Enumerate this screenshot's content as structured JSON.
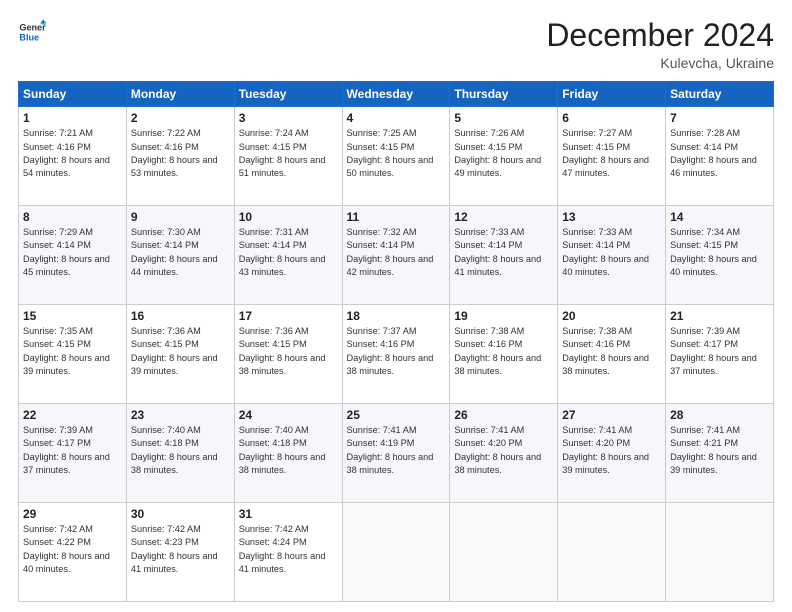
{
  "header": {
    "logo_line1": "General",
    "logo_line2": "Blue",
    "month_title": "December 2024",
    "location": "Kulevcha, Ukraine"
  },
  "days_of_week": [
    "Sunday",
    "Monday",
    "Tuesday",
    "Wednesday",
    "Thursday",
    "Friday",
    "Saturday"
  ],
  "weeks": [
    [
      {
        "day": "1",
        "sunrise": "7:21 AM",
        "sunset": "4:16 PM",
        "daylight": "8 hours and 54 minutes."
      },
      {
        "day": "2",
        "sunrise": "7:22 AM",
        "sunset": "4:16 PM",
        "daylight": "8 hours and 53 minutes."
      },
      {
        "day": "3",
        "sunrise": "7:24 AM",
        "sunset": "4:15 PM",
        "daylight": "8 hours and 51 minutes."
      },
      {
        "day": "4",
        "sunrise": "7:25 AM",
        "sunset": "4:15 PM",
        "daylight": "8 hours and 50 minutes."
      },
      {
        "day": "5",
        "sunrise": "7:26 AM",
        "sunset": "4:15 PM",
        "daylight": "8 hours and 49 minutes."
      },
      {
        "day": "6",
        "sunrise": "7:27 AM",
        "sunset": "4:15 PM",
        "daylight": "8 hours and 47 minutes."
      },
      {
        "day": "7",
        "sunrise": "7:28 AM",
        "sunset": "4:14 PM",
        "daylight": "8 hours and 46 minutes."
      }
    ],
    [
      {
        "day": "8",
        "sunrise": "7:29 AM",
        "sunset": "4:14 PM",
        "daylight": "8 hours and 45 minutes."
      },
      {
        "day": "9",
        "sunrise": "7:30 AM",
        "sunset": "4:14 PM",
        "daylight": "8 hours and 44 minutes."
      },
      {
        "day": "10",
        "sunrise": "7:31 AM",
        "sunset": "4:14 PM",
        "daylight": "8 hours and 43 minutes."
      },
      {
        "day": "11",
        "sunrise": "7:32 AM",
        "sunset": "4:14 PM",
        "daylight": "8 hours and 42 minutes."
      },
      {
        "day": "12",
        "sunrise": "7:33 AM",
        "sunset": "4:14 PM",
        "daylight": "8 hours and 41 minutes."
      },
      {
        "day": "13",
        "sunrise": "7:33 AM",
        "sunset": "4:14 PM",
        "daylight": "8 hours and 40 minutes."
      },
      {
        "day": "14",
        "sunrise": "7:34 AM",
        "sunset": "4:15 PM",
        "daylight": "8 hours and 40 minutes."
      }
    ],
    [
      {
        "day": "15",
        "sunrise": "7:35 AM",
        "sunset": "4:15 PM",
        "daylight": "8 hours and 39 minutes."
      },
      {
        "day": "16",
        "sunrise": "7:36 AM",
        "sunset": "4:15 PM",
        "daylight": "8 hours and 39 minutes."
      },
      {
        "day": "17",
        "sunrise": "7:36 AM",
        "sunset": "4:15 PM",
        "daylight": "8 hours and 38 minutes."
      },
      {
        "day": "18",
        "sunrise": "7:37 AM",
        "sunset": "4:16 PM",
        "daylight": "8 hours and 38 minutes."
      },
      {
        "day": "19",
        "sunrise": "7:38 AM",
        "sunset": "4:16 PM",
        "daylight": "8 hours and 38 minutes."
      },
      {
        "day": "20",
        "sunrise": "7:38 AM",
        "sunset": "4:16 PM",
        "daylight": "8 hours and 38 minutes."
      },
      {
        "day": "21",
        "sunrise": "7:39 AM",
        "sunset": "4:17 PM",
        "daylight": "8 hours and 37 minutes."
      }
    ],
    [
      {
        "day": "22",
        "sunrise": "7:39 AM",
        "sunset": "4:17 PM",
        "daylight": "8 hours and 37 minutes."
      },
      {
        "day": "23",
        "sunrise": "7:40 AM",
        "sunset": "4:18 PM",
        "daylight": "8 hours and 38 minutes."
      },
      {
        "day": "24",
        "sunrise": "7:40 AM",
        "sunset": "4:18 PM",
        "daylight": "8 hours and 38 minutes."
      },
      {
        "day": "25",
        "sunrise": "7:41 AM",
        "sunset": "4:19 PM",
        "daylight": "8 hours and 38 minutes."
      },
      {
        "day": "26",
        "sunrise": "7:41 AM",
        "sunset": "4:20 PM",
        "daylight": "8 hours and 38 minutes."
      },
      {
        "day": "27",
        "sunrise": "7:41 AM",
        "sunset": "4:20 PM",
        "daylight": "8 hours and 39 minutes."
      },
      {
        "day": "28",
        "sunrise": "7:41 AM",
        "sunset": "4:21 PM",
        "daylight": "8 hours and 39 minutes."
      }
    ],
    [
      {
        "day": "29",
        "sunrise": "7:42 AM",
        "sunset": "4:22 PM",
        "daylight": "8 hours and 40 minutes."
      },
      {
        "day": "30",
        "sunrise": "7:42 AM",
        "sunset": "4:23 PM",
        "daylight": "8 hours and 41 minutes."
      },
      {
        "day": "31",
        "sunrise": "7:42 AM",
        "sunset": "4:24 PM",
        "daylight": "8 hours and 41 minutes."
      },
      null,
      null,
      null,
      null
    ]
  ],
  "labels": {
    "sunrise": "Sunrise:",
    "sunset": "Sunset:",
    "daylight": "Daylight:"
  }
}
